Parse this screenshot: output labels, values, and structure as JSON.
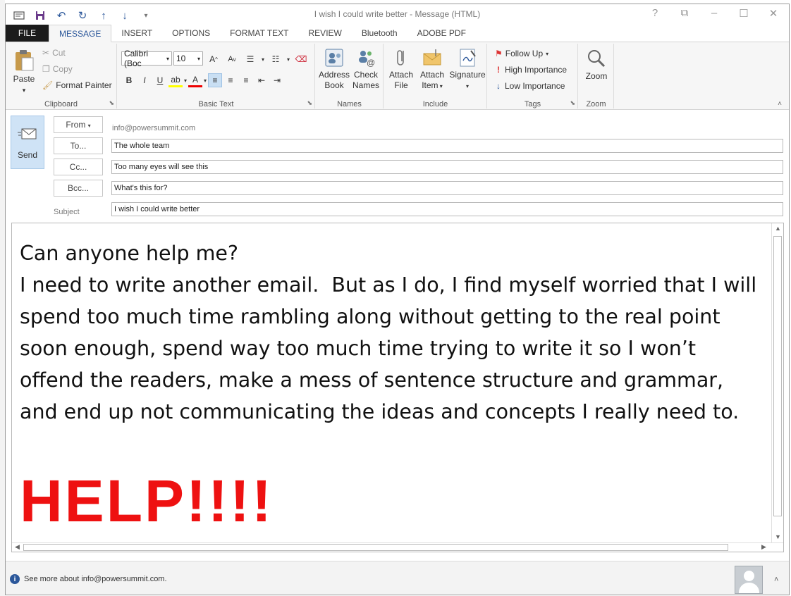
{
  "window": {
    "title": "I wish I could write better - Message (HTML)"
  },
  "qat": {
    "icons": [
      "mail-icon",
      "save-icon",
      "undo-icon",
      "redo-icon",
      "up-icon",
      "down-icon",
      "customize-icon"
    ]
  },
  "win_controls": {
    "help": "?",
    "restore_ribbon": "⧉",
    "minimize": "‒",
    "maximize": "☐",
    "close": "✕"
  },
  "tabs": [
    {
      "label": "FILE"
    },
    {
      "label": "MESSAGE"
    },
    {
      "label": "INSERT"
    },
    {
      "label": "OPTIONS"
    },
    {
      "label": "FORMAT TEXT"
    },
    {
      "label": "REVIEW"
    },
    {
      "label": "Bluetooth"
    },
    {
      "label": "ADOBE PDF"
    }
  ],
  "ribbon": {
    "clipboard": {
      "paste": "Paste",
      "cut": "Cut",
      "copy": "Copy",
      "format_painter": "Format Painter",
      "label": "Clipboard"
    },
    "basic_text": {
      "font": "Calibri (Boc",
      "size": "10",
      "label": "Basic Text"
    },
    "names": {
      "address_book": "Address",
      "address_book2": "Book",
      "check_names": "Check",
      "check_names2": "Names",
      "label": "Names"
    },
    "include": {
      "attach_file": "Attach",
      "attach_file2": "File",
      "attach_item": "Attach",
      "attach_item2": "Item",
      "signature": "Signature",
      "label": "Include"
    },
    "tags": {
      "follow_up": "Follow Up",
      "high_importance": "High Importance",
      "low_importance": "Low Importance",
      "label": "Tags"
    },
    "zoom": {
      "zoom": "Zoom",
      "label": "Zoom"
    }
  },
  "header": {
    "send": "Send",
    "from_btn": "From",
    "from_value": "info@powersummit.com",
    "to_btn": "To...",
    "to_value": "The whole team",
    "cc_btn": "Cc...",
    "cc_value": "Too many eyes will see this",
    "bcc_btn": "Bcc...",
    "bcc_value": "What's this for?",
    "subject_label": "Subject",
    "subject_value": "I wish I could write better"
  },
  "body": {
    "text": "Can anyone help me?\nI need to write another email.  But as I do, I find myself worried that I will spend too much time rambling along without getting to the real point soon enough, spend way too much time trying to write it so I won’t offend the readers, make a mess of sentence structure and grammar, and end up not communicating the ideas and concepts I really need to.",
    "help": "HELP!!!!",
    "help_color": "#ee1111"
  },
  "footer": {
    "info": "See more about info@powersummit.com."
  },
  "colors": {
    "accent": "#2b579a",
    "file_tab": "#1b1b1b",
    "send_bg": "#cfe3f6"
  }
}
